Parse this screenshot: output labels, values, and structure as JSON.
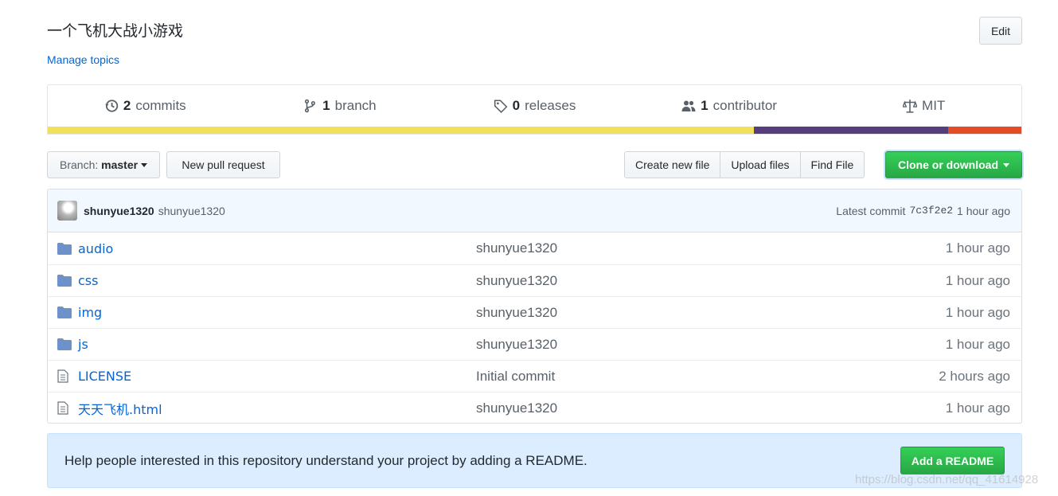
{
  "repo": {
    "description": "一个飞机大战小游戏",
    "manage_topics": "Manage topics",
    "edit_label": "Edit"
  },
  "summary": {
    "commits_count": "2",
    "commits_label": "commits",
    "branch_count": "1",
    "branch_label": "branch",
    "releases_count": "0",
    "releases_label": "releases",
    "contributor_count": "1",
    "contributor_label": "contributor",
    "license": "MIT",
    "language_bar": [
      {
        "color": "#f1e05a",
        "fraction": 0.725
      },
      {
        "color": "#563d7c",
        "fraction": 0.2
      },
      {
        "color": "#e34c26",
        "fraction": 0.075
      }
    ]
  },
  "toolbar": {
    "branch_prefix": "Branch:",
    "branch_name": "master",
    "new_pull_request": "New pull request",
    "create_new_file": "Create new file",
    "upload_files": "Upload files",
    "find_file": "Find File",
    "clone_or_download": "Clone or download"
  },
  "latest_commit": {
    "author": "shunyue1320",
    "message": "shunyue1320",
    "prefix": "Latest commit",
    "sha": "7c3f2e2",
    "time": "1 hour ago"
  },
  "files": [
    {
      "type": "folder",
      "name": "audio",
      "message": "shunyue1320",
      "age": "1 hour ago"
    },
    {
      "type": "folder",
      "name": "css",
      "message": "shunyue1320",
      "age": "1 hour ago"
    },
    {
      "type": "folder",
      "name": "img",
      "message": "shunyue1320",
      "age": "1 hour ago"
    },
    {
      "type": "folder",
      "name": "js",
      "message": "shunyue1320",
      "age": "1 hour ago"
    },
    {
      "type": "file",
      "name": "LICENSE",
      "message": "Initial commit",
      "age": "2 hours ago"
    },
    {
      "type": "file",
      "name": "天天飞机.html",
      "message": "shunyue1320",
      "age": "1 hour ago"
    }
  ],
  "readme": {
    "text": "Help people interested in this repository understand your project by adding a README.",
    "button": "Add a README"
  },
  "watermark": "https://blog.csdn.net/qq_41614928"
}
